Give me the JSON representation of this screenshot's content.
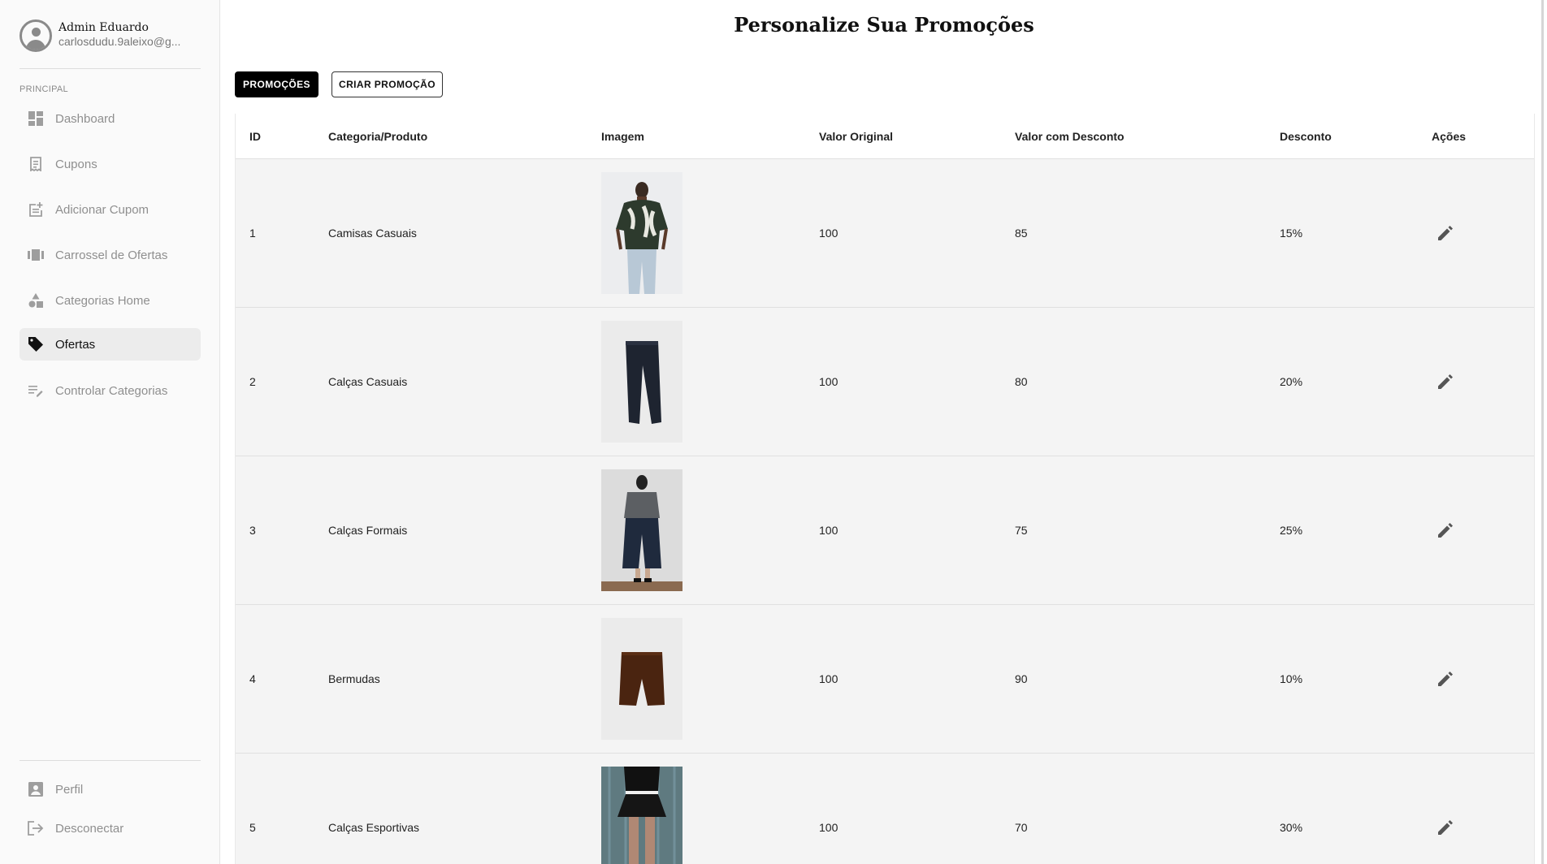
{
  "user": {
    "name": "Admin Eduardo",
    "email": "carlosdudu.9aleixo@g..."
  },
  "sidebar": {
    "section_label": "PRINCIPAL",
    "items": [
      {
        "label": "Dashboard",
        "icon": "dashboard-icon",
        "active": false
      },
      {
        "label": "Cupons",
        "icon": "receipt-icon",
        "active": false
      },
      {
        "label": "Adicionar Cupom",
        "icon": "post-add-icon",
        "active": false
      },
      {
        "label": "Carrossel de Ofertas",
        "icon": "carousel-icon",
        "active": false
      },
      {
        "label": "Categorias Home",
        "icon": "category-icon",
        "active": false
      },
      {
        "label": "Ofertas",
        "icon": "tag-icon",
        "active": true
      },
      {
        "label": "Controlar Categorias",
        "icon": "edit-list-icon",
        "active": false
      }
    ],
    "bottom_items": [
      {
        "label": "Perfil",
        "icon": "account-box-icon"
      },
      {
        "label": "Desconectar",
        "icon": "logout-icon"
      }
    ]
  },
  "page": {
    "title": "Personalize Sua Promoções"
  },
  "toolbar": {
    "promocoes_label": "PROMOÇÕES",
    "criar_label": "CRIAR PROMOÇÃO"
  },
  "table": {
    "headers": [
      "ID",
      "Categoria/Produto",
      "Imagem",
      "Valor Original",
      "Valor com Desconto",
      "Desconto",
      "Ações"
    ],
    "rows": [
      {
        "id": "1",
        "product": "Camisas Casuais",
        "image": "printed-shirt-model",
        "original": "100",
        "discounted": "85",
        "discount": "15%"
      },
      {
        "id": "2",
        "product": "Calças Casuais",
        "image": "black-trousers",
        "original": "100",
        "discounted": "80",
        "discount": "20%"
      },
      {
        "id": "3",
        "product": "Calças Formais",
        "image": "wide-leg-pants-model",
        "original": "100",
        "discounted": "75",
        "discount": "25%"
      },
      {
        "id": "4",
        "product": "Bermudas",
        "image": "brown-shorts",
        "original": "100",
        "discounted": "90",
        "discount": "10%"
      },
      {
        "id": "5",
        "product": "Calças Esportivas",
        "image": "black-skirt-model",
        "original": "100",
        "discounted": "70",
        "discount": "30%"
      }
    ]
  },
  "colors": {
    "primary": "#000000",
    "sidebar_bg": "#fafafa",
    "row_bg": "#f4f4f4",
    "active_nav_bg": "#ececec"
  }
}
